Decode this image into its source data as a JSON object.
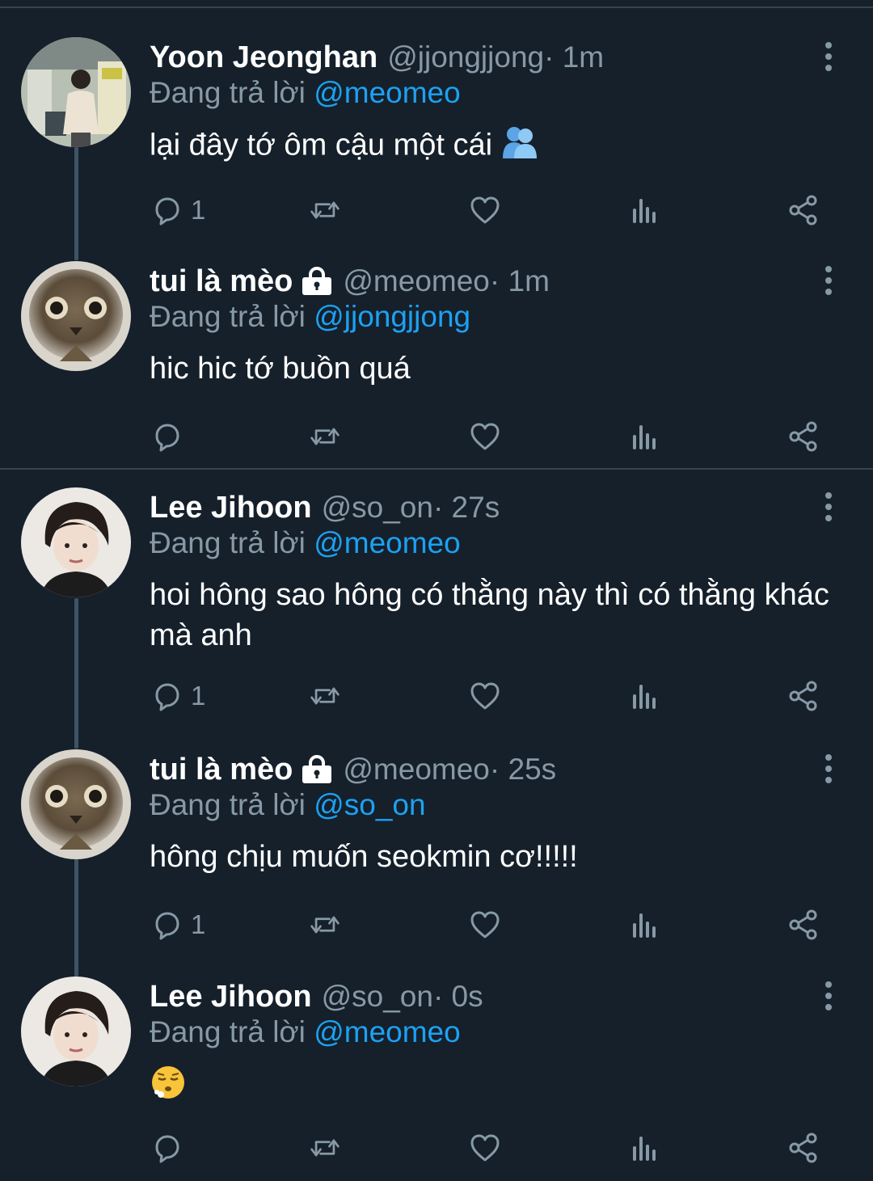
{
  "theme": {
    "background": "#15202b",
    "muted": "#8899a6",
    "link": "#1da1f2",
    "divider": "#38444d"
  },
  "reply_prefix": "Đang trả lời",
  "tweets": [
    {
      "name": "Yoon Jeonghan",
      "handle": "@jjongjjong",
      "time": " · 1m",
      "reply_to": "@meomeo",
      "text": "lại đây tớ ôm cậu một cái",
      "emoji": "hugging-people-icon",
      "reply_count": "1",
      "locked": false,
      "avatar": "person-station-avatar"
    },
    {
      "name": "tui là mèo",
      "handle": "@meomeo",
      "time": " · 1m",
      "reply_to": "@jjongjjong",
      "text": "hic hic tớ buồn quá",
      "reply_count": "",
      "locked": true,
      "avatar": "cat-avatar"
    },
    {
      "name": "Lee Jihoon",
      "handle": "@so_on",
      "time": " · 27s",
      "reply_to": "@meomeo",
      "text": "hoi hông sao hông có thằng này thì có thằng khác mà anh",
      "reply_count": "1",
      "locked": false,
      "avatar": "person-avatar"
    },
    {
      "name": "tui là mèo",
      "handle": "@meomeo",
      "time": " · 25s",
      "reply_to": "@so_on",
      "text": "hông chịu muốn seokmin cơ!!!!!",
      "reply_count": "1",
      "locked": true,
      "avatar": "cat-avatar"
    },
    {
      "name": "Lee Jihoon",
      "handle": "@so_on",
      "time": " · 0s",
      "reply_to": "@meomeo",
      "text": "",
      "emoji": "face-exhaling-icon",
      "reply_count": "",
      "locked": false,
      "avatar": "person-avatar"
    }
  ]
}
